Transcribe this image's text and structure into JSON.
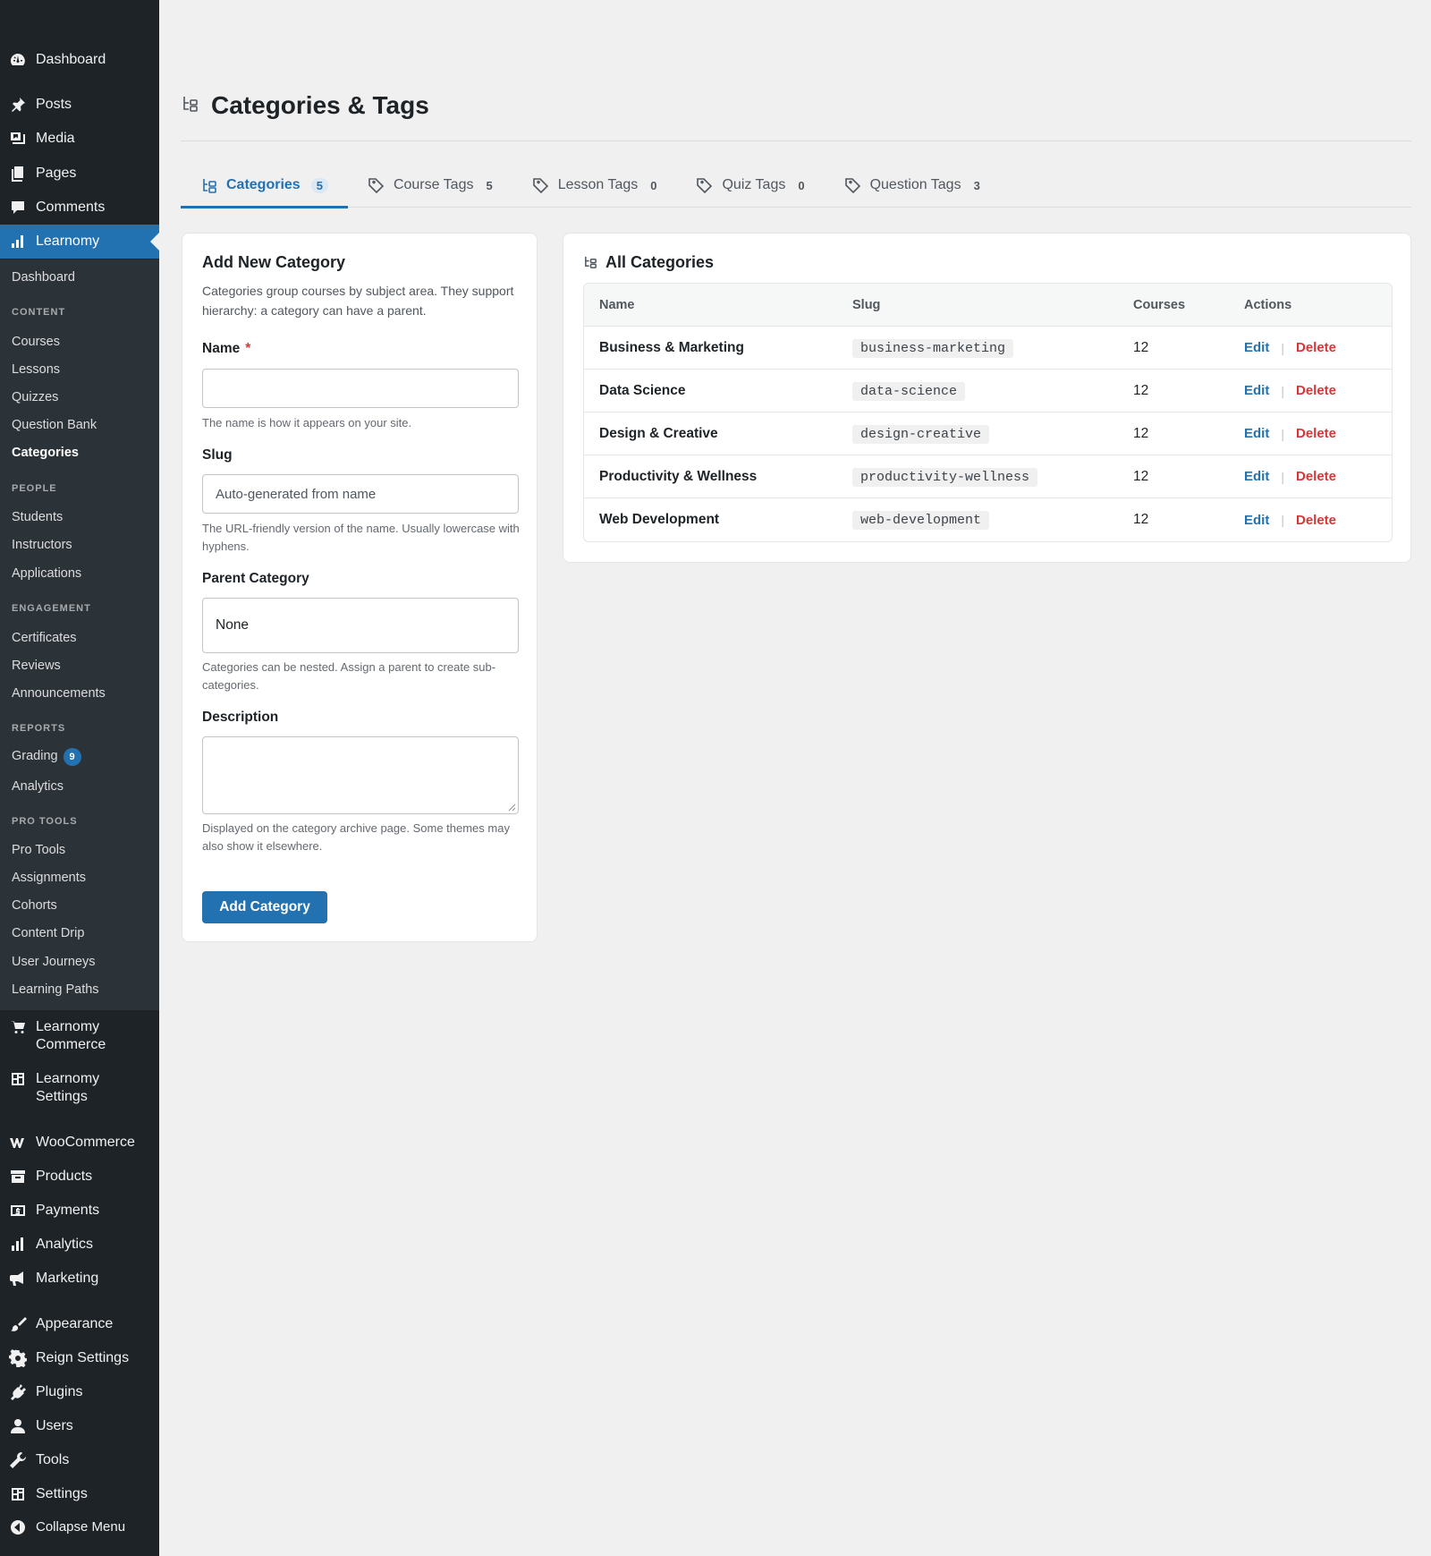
{
  "sidebar": {
    "top_items": [
      {
        "label": "Dashboard",
        "icon": "dashboard-icon"
      },
      {
        "label": "Posts",
        "icon": "pin-icon"
      },
      {
        "label": "Media",
        "icon": "media-icon"
      },
      {
        "label": "Pages",
        "icon": "pages-icon"
      },
      {
        "label": "Comments",
        "icon": "comment-icon"
      },
      {
        "label": "Learnomy",
        "icon": "chart-icon"
      }
    ],
    "submenu": {
      "dashboard": "Dashboard",
      "content_heading": "CONTENT",
      "content": [
        "Courses",
        "Lessons",
        "Quizzes",
        "Question Bank",
        "Categories"
      ],
      "people_heading": "PEOPLE",
      "people": [
        "Students",
        "Instructors",
        "Applications"
      ],
      "engagement_heading": "ENGAGEMENT",
      "engagement": [
        "Certificates",
        "Reviews",
        "Announcements"
      ],
      "reports_heading": "REPORTS",
      "reports": [
        "Grading",
        "Analytics"
      ],
      "grading_badge": "9",
      "protools_heading": "PRO TOOLS",
      "protools": [
        "Pro Tools",
        "Assignments",
        "Cohorts",
        "Content Drip",
        "User Journeys",
        "Learning Paths"
      ]
    },
    "bottom_items": [
      {
        "label": "Learnomy\nCommerce",
        "icon": "cart-icon"
      },
      {
        "label": "Learnomy\nSettings",
        "icon": "settings-grid-icon"
      },
      {
        "label": "WooCommerce",
        "icon": "woo-icon"
      },
      {
        "label": "Products",
        "icon": "archive-icon"
      },
      {
        "label": "Payments",
        "icon": "dollar-icon"
      },
      {
        "label": "Analytics",
        "icon": "bar-chart-icon"
      },
      {
        "label": "Marketing",
        "icon": "megaphone-icon"
      },
      {
        "label": "Appearance",
        "icon": "brush-icon"
      },
      {
        "label": "Reign Settings",
        "icon": "gear-icon"
      },
      {
        "label": "Plugins",
        "icon": "plug-icon"
      },
      {
        "label": "Users",
        "icon": "user-icon"
      },
      {
        "label": "Tools",
        "icon": "wrench-icon"
      },
      {
        "label": "Settings",
        "icon": "sliders-icon"
      },
      {
        "label": "Collapse Menu",
        "icon": "collapse-icon"
      }
    ]
  },
  "page": {
    "title": "Categories & Tags",
    "tabs": [
      {
        "label": "Categories",
        "count": "5"
      },
      {
        "label": "Course Tags",
        "count": "5"
      },
      {
        "label": "Lesson Tags",
        "count": "0"
      },
      {
        "label": "Quiz Tags",
        "count": "0"
      },
      {
        "label": "Question Tags",
        "count": "3"
      }
    ]
  },
  "form": {
    "title": "Add New Category",
    "description": "Categories group courses by subject area. They support hierarchy: a category can have a parent.",
    "name_label": "Name",
    "name_required": "*",
    "name_value": "",
    "name_help": "The name is how it appears on your site.",
    "slug_label": "Slug",
    "slug_placeholder": "Auto-generated from name",
    "slug_help": "The URL-friendly version of the name. Usually lowercase with hyphens.",
    "parent_label": "Parent Category",
    "parent_value": "None",
    "parent_help": "Categories can be nested. Assign a parent to create sub-categories.",
    "description_label": "Description",
    "description_help": "Displayed on the category archive page. Some themes may also show it elsewhere.",
    "submit_label": "Add Category"
  },
  "table": {
    "title": "All Categories",
    "columns": [
      "Name",
      "Slug",
      "Courses",
      "Actions"
    ],
    "edit_label": "Edit",
    "separator": "|",
    "delete_label": "Delete",
    "rows": [
      {
        "name": "Business & Marketing",
        "slug": "business-marketing",
        "courses": "12"
      },
      {
        "name": "Data Science",
        "slug": "data-science",
        "courses": "12"
      },
      {
        "name": "Design & Creative",
        "slug": "design-creative",
        "courses": "12"
      },
      {
        "name": "Productivity & Wellness",
        "slug": "productivity-wellness",
        "courses": "12"
      },
      {
        "name": "Web Development",
        "slug": "web-development",
        "courses": "12"
      }
    ]
  },
  "colors": {
    "accent": "#2271b1",
    "sidebar_bg": "#1d2327",
    "delete": "#d63638"
  }
}
